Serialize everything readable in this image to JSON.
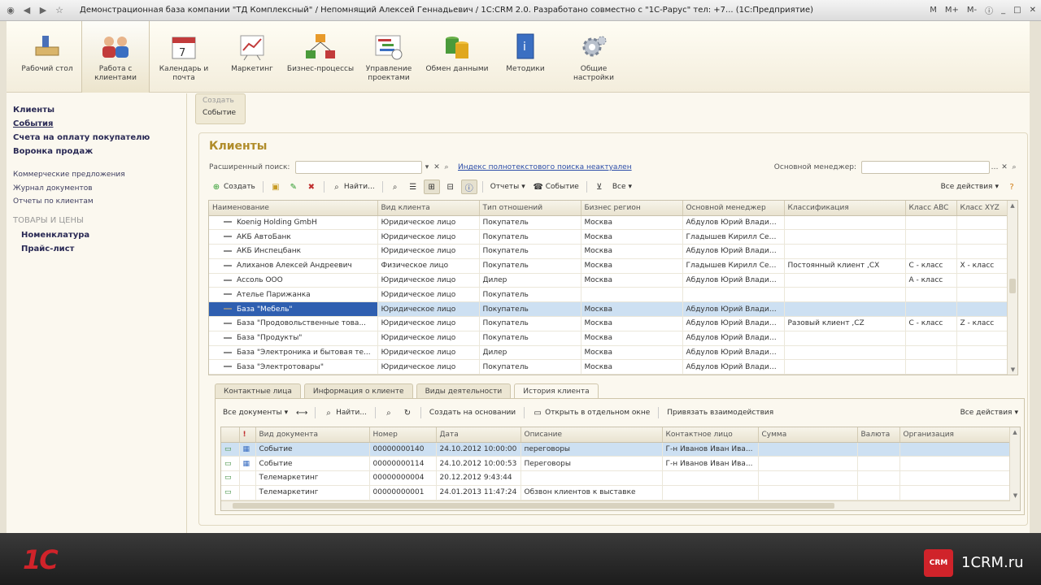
{
  "window": {
    "title": "Демонстрационная база компании \"ТД Комплексный\" / Непомнящий Алексей Геннадьевич / 1С:CRM 2.0. Разработано совместно с \"1С-Рарус\" тел: +7... (1С:Предприятие)",
    "buttons": [
      "M",
      "M+",
      "M-"
    ]
  },
  "sections": [
    {
      "label": "Рабочий стол",
      "icon": "desk-icon"
    },
    {
      "label": "Работа с клиентами",
      "icon": "clients-icon"
    },
    {
      "label": "Календарь и почта",
      "icon": "calendar-icon"
    },
    {
      "label": "Маркетинг",
      "icon": "marketing-icon"
    },
    {
      "label": "Бизнес-процессы",
      "icon": "business-process-icon"
    },
    {
      "label": "Управление проектами",
      "icon": "projects-icon"
    },
    {
      "label": "Обмен данными",
      "icon": "data-exchange-icon"
    },
    {
      "label": "Методики",
      "icon": "methods-icon"
    },
    {
      "label": "Общие настройки",
      "icon": "settings-gear-icon"
    }
  ],
  "nav": {
    "main": [
      "Клиенты",
      "События",
      "Счета на оплату покупателю",
      "Воронка продаж"
    ],
    "sub": [
      "Коммерческие предложения",
      "Журнал документов",
      "Отчеты по клиентам"
    ],
    "group": "ТОВАРЫ И ЦЕНЫ",
    "group_items": [
      "Номенклатура",
      "Прайс-лист"
    ]
  },
  "create_panel": {
    "title": "Создать",
    "item": "Событие"
  },
  "form": {
    "title": "Клиенты",
    "search_label": "Расширенный поиск:",
    "index_link": "Индекс полнотекстового поиска неактуален",
    "manager_label": "Основной менеджер:",
    "toolbar": {
      "create": "Создать",
      "find": "Найти...",
      "reports": "Отчеты",
      "event": "Событие",
      "all": "Все",
      "all_actions": "Все действия"
    }
  },
  "clients_table": {
    "columns": [
      "Наименование",
      "Вид клиента",
      "Тип отношений",
      "Бизнес регион",
      "Основной менеджер",
      "Классификация",
      "Класс ABC",
      "Класс XYZ"
    ],
    "rows": [
      [
        "Koenig Holding GmbH",
        "Юридическое лицо",
        "Покупатель",
        "Москва",
        "Абдулов Юрий Владим...",
        "",
        "",
        ""
      ],
      [
        "АКБ АвтоБанк",
        "Юридическое лицо",
        "Покупатель",
        "Москва",
        "Гладышев Кирилл Сер...",
        "",
        "",
        ""
      ],
      [
        "АКБ Инспецбанк",
        "Юридическое лицо",
        "Покупатель",
        "Москва",
        "Абдулов Юрий Владим...",
        "",
        "",
        ""
      ],
      [
        "Алиханов Алексей Андреевич",
        "Физическое лицо",
        "Покупатель",
        "Москва",
        "Гладышев Кирилл Сер...",
        "Постоянный клиент ,CX",
        "C - класс",
        "X - класс"
      ],
      [
        "Ассоль ООО",
        "Юридическое лицо",
        "Дилер",
        "Москва",
        "Абдулов Юрий Владим...",
        "",
        "A - класс",
        ""
      ],
      [
        "Ателье Парижанка",
        "Юридическое лицо",
        "Покупатель",
        "",
        "",
        "",
        "",
        ""
      ],
      [
        "База \"Мебель\"",
        "Юридическое лицо",
        "Покупатель",
        "Москва",
        "Абдулов Юрий Владим...",
        "",
        "",
        ""
      ],
      [
        "База \"Продовольственные това...",
        "Юридическое лицо",
        "Покупатель",
        "Москва",
        "Абдулов Юрий Владим...",
        "Разовый клиент ,CZ",
        "C - класс",
        "Z - класс"
      ],
      [
        "База \"Продукты\"",
        "Юридическое лицо",
        "Покупатель",
        "Москва",
        "Абдулов Юрий Владим...",
        "",
        "",
        ""
      ],
      [
        "База \"Электроника и бытовая те...",
        "Юридическое лицо",
        "Дилер",
        "Москва",
        "Абдулов Юрий Владим...",
        "",
        "",
        ""
      ],
      [
        "База \"Электротовары\"",
        "Юридическое лицо",
        "Покупатель",
        "Москва",
        "Абдулов Юрий Владим...",
        "",
        "",
        ""
      ]
    ],
    "selected_row": 6
  },
  "tabs": [
    "Контактные лица",
    "Информация о клиенте",
    "Виды деятельности",
    "История клиента"
  ],
  "history": {
    "toolbar": {
      "all_docs": "Все документы",
      "find": "Найти...",
      "create_on_basis": "Создать на основании",
      "open_window": "Открыть в отдельном окне",
      "link": "Привязать взаимодействия",
      "all_actions": "Все действия"
    },
    "columns": [
      "Вид документа",
      "Номер",
      "Дата",
      "Описание",
      "Контактное лицо",
      "Сумма",
      "Валюта",
      "Организация"
    ],
    "rows": [
      [
        "Событие",
        "00000000140",
        "24.10.2012 10:00:00",
        "переговоры",
        "Г-н Иванов Иван Ива...",
        "",
        "",
        ""
      ],
      [
        "Событие",
        "00000000114",
        "24.10.2012 10:00:53",
        "Переговоры",
        "Г-н Иванов Иван Ива...",
        "",
        "",
        ""
      ],
      [
        "Телемаркетинг",
        "00000000004",
        "20.12.2012 9:43:44",
        "",
        "",
        "",
        "",
        ""
      ],
      [
        "Телемаркетинг",
        "00000000001",
        "24.01.2013 11:47:24",
        "Обзвон клиентов к выставке",
        "",
        "",
        "",
        ""
      ]
    ]
  },
  "branding": {
    "logo": "1С",
    "badge": "CRM",
    "url": "1CRM.ru"
  }
}
